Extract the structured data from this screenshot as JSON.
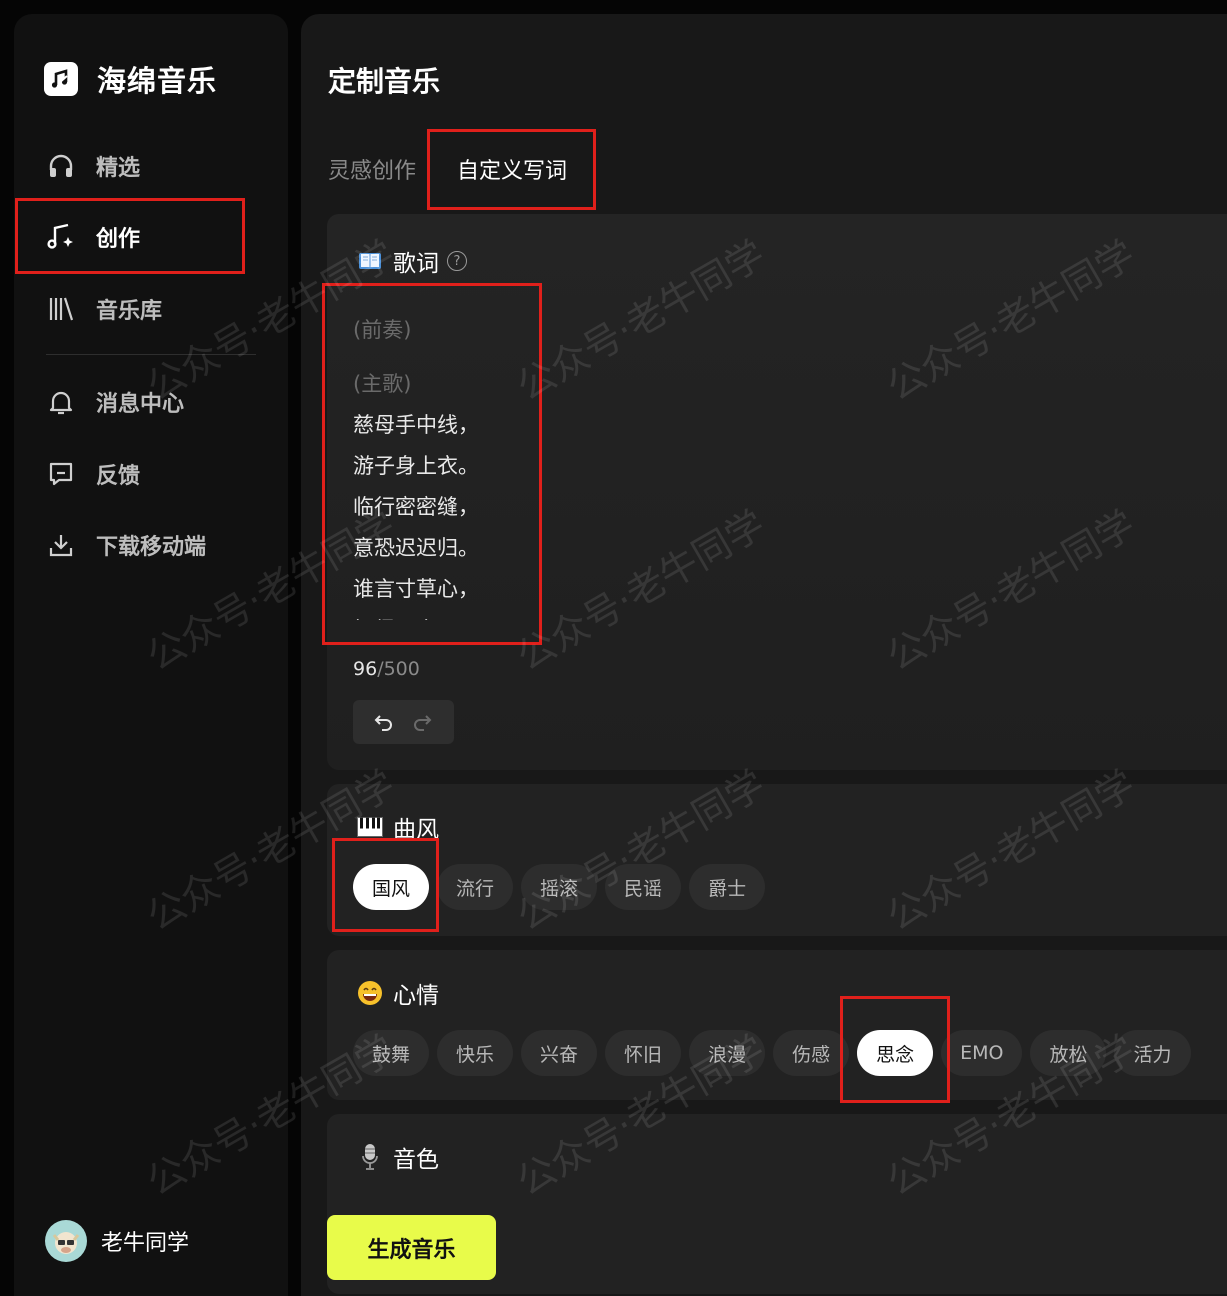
{
  "app": {
    "name": "海绵音乐"
  },
  "sidebar": {
    "items": [
      {
        "id": "featured",
        "label": "精选",
        "icon": "headphones-icon"
      },
      {
        "id": "create",
        "label": "创作",
        "icon": "music-note-sparkle-icon",
        "active": true
      },
      {
        "id": "library",
        "label": "音乐库",
        "icon": "library-icon"
      },
      {
        "id": "messages",
        "label": "消息中心",
        "icon": "bell-icon"
      },
      {
        "id": "feedback",
        "label": "反馈",
        "icon": "feedback-icon"
      },
      {
        "id": "download",
        "label": "下载移动端",
        "icon": "download-icon"
      }
    ],
    "user": {
      "name": "老牛同学"
    }
  },
  "main": {
    "title": "定制音乐",
    "tabs": [
      {
        "label": "灵感创作",
        "active": false
      },
      {
        "label": "自定义写词",
        "active": true
      }
    ],
    "lyrics": {
      "title": "歌词",
      "lines": [
        "(前奏)",
        "(主歌)",
        "慈母手中线，",
        "游子身上衣。",
        "临行密密缝，",
        "意恐迟迟归。",
        "谁言寸草心，",
        "报得三春晖。"
      ],
      "count": "96",
      "max": "/500"
    },
    "style": {
      "title": "曲风",
      "options": [
        "国风",
        "流行",
        "摇滚",
        "民谣",
        "爵士"
      ],
      "selected": "国风"
    },
    "mood": {
      "title": "心情",
      "options": [
        "鼓舞",
        "快乐",
        "兴奋",
        "怀旧",
        "浪漫",
        "伤感",
        "思念",
        "EMO",
        "放松",
        "活力"
      ],
      "selected": "思念"
    },
    "voice": {
      "title": "音色"
    },
    "generate_label": "生成音乐"
  },
  "watermark": "公众号·老牛同学",
  "colors": {
    "accent": "#e8fb4a",
    "annotation": "#e0201b",
    "background": "#181818"
  }
}
